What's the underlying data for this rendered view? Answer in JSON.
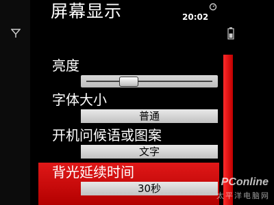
{
  "status_bar": {
    "title": "屏幕显示",
    "time": "20:02"
  },
  "settings": {
    "brightness": {
      "label": "亮度",
      "level_fraction": 0.32
    },
    "font_size": {
      "label": "字体大小",
      "value": "普通"
    },
    "greeting": {
      "label": "开机问候语或图案",
      "value": "文字"
    },
    "backlight": {
      "label": "背光延续时间",
      "value": "30秒",
      "selected": true
    }
  },
  "scrollbar": {
    "position_fraction": 1.0
  },
  "watermark": {
    "main": "PConline",
    "sub": "太平洋电脑网"
  },
  "colors": {
    "accent": "#d40000",
    "background": "#000000"
  },
  "icons": [
    "signal-icon",
    "battery-icon",
    "alarm-icon"
  ]
}
